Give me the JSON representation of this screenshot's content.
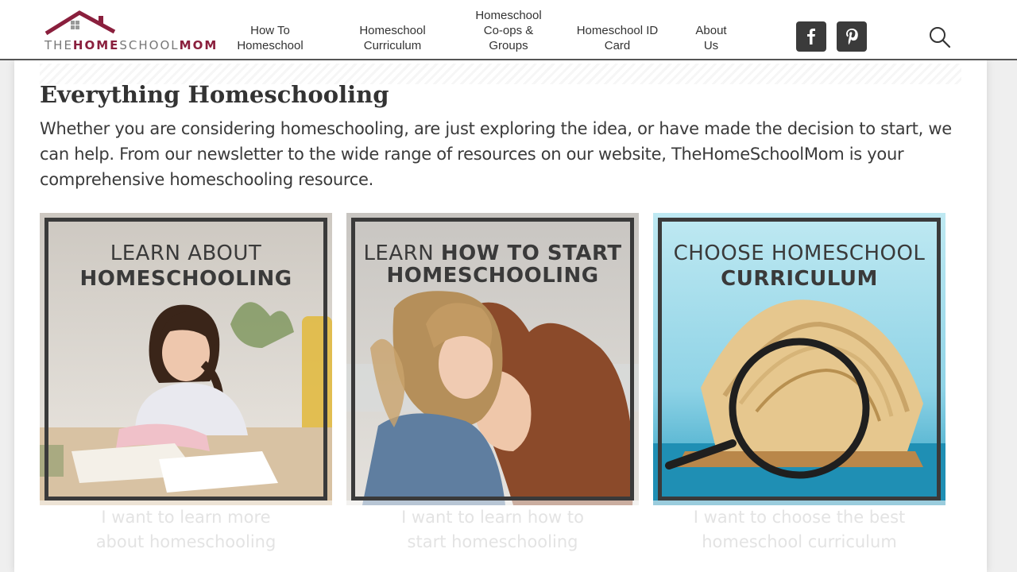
{
  "header": {
    "logo": {
      "part1": "THE",
      "part2": "HOME",
      "part3": "SCHOOL",
      "part4": "MOM",
      "icon": "house-roof-icon",
      "color": "#8a1f3d"
    },
    "nav": [
      {
        "lines": [
          "How To",
          "Homeschool"
        ]
      },
      {
        "lines": [
          "Homeschool",
          "Curriculum"
        ]
      },
      {
        "lines": [
          "Homeschool",
          "Co-ops &",
          "Groups"
        ]
      },
      {
        "lines": [
          "Homeschool ID",
          "Card"
        ]
      },
      {
        "lines": [
          "About",
          "Us"
        ]
      }
    ],
    "social": [
      {
        "icon": "facebook-icon",
        "glyph": "f"
      },
      {
        "icon": "pinterest-icon",
        "glyph": "P"
      }
    ],
    "search_icon": "search-icon"
  },
  "main": {
    "title": "Everything Homeschooling",
    "intro": "Whether you are considering homeschooling, are just exploring the idea, or have made the decision to start, we can help. From our newsletter to the wide range of resources on our website, TheHomeSchoolMom is your comprehensive homeschooling resource.",
    "cards": [
      {
        "line1_thin": "LEARN ABOUT",
        "line1_bold": "",
        "line2": "HOMESCHOOLING",
        "caption_lines": [
          "I want to learn more",
          "about homeschooling"
        ],
        "bg": "#cfcac3"
      },
      {
        "line1_thin": "LEARN ",
        "line1_bold": "HOW TO START",
        "line2": "HOMESCHOOLING",
        "caption_lines": [
          "I want to learn how to",
          "start homeschooling"
        ],
        "bg": "#c9c6c2"
      },
      {
        "line1_thin": "CHOOSE HOMESCHOOL",
        "line1_bold": "",
        "line2": "CURRICULUM",
        "caption_lines": [
          "I want to choose the best",
          "homeschool curriculum"
        ],
        "bg": "#b5e4ef"
      }
    ]
  }
}
